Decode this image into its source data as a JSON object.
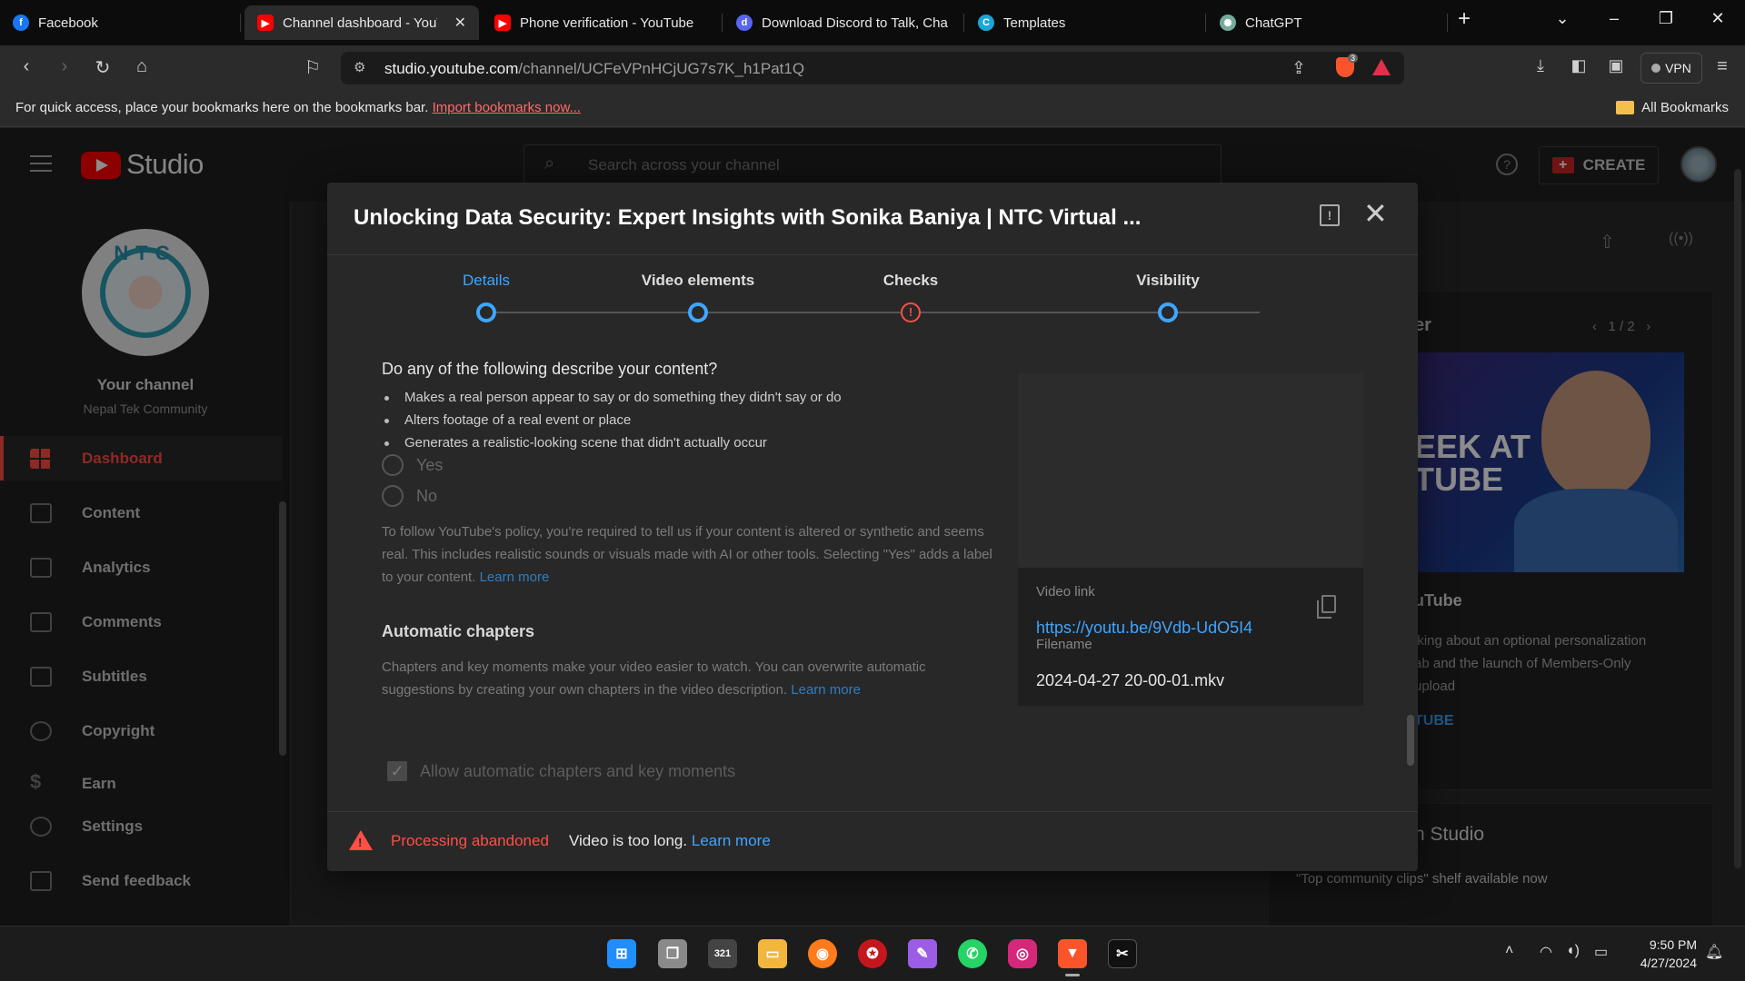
{
  "browser": {
    "tabs": [
      {
        "title": "Facebook",
        "icon": "facebook-icon",
        "color": "#1877f2",
        "glyph": "f"
      },
      {
        "title": "Channel dashboard - YouTube Studio",
        "icon": "youtube-icon",
        "color": "#ff0000",
        "glyph": "▶",
        "active": true
      },
      {
        "title": "Phone verification - YouTube",
        "icon": "youtube-icon",
        "color": "#ff0000",
        "glyph": "▶"
      },
      {
        "title": "Download Discord to Talk, Chat",
        "icon": "discord-icon",
        "color": "#5865f2",
        "glyph": "d"
      },
      {
        "title": "Templates",
        "icon": "canva-icon",
        "color": "#1aa6d6",
        "glyph": "C"
      },
      {
        "title": "ChatGPT",
        "icon": "chatgpt-icon",
        "color": "#74aa9c",
        "glyph": "✺"
      }
    ],
    "url_host": "studio.youtube.com",
    "url_path": "/channel/UCFeVPnHCjUG7s7K_h1Pat1Q",
    "brave_badge": "3",
    "vpn_label": "VPN",
    "bookmarks_msg": "For quick access, place your bookmarks here on the bookmarks bar.",
    "bookmarks_link": "Import bookmarks now...",
    "all_bookmarks": "All Bookmarks"
  },
  "studio": {
    "logo_text": "Studio",
    "search_placeholder": "Search across your channel",
    "create_label": "CREATE",
    "channel_title": "Your channel",
    "channel_name": "Nepal Tek Community",
    "avatar_text": "NTC",
    "nav": [
      {
        "label": "Dashboard",
        "icon": "dashboard-icon",
        "active": true
      },
      {
        "label": "Content",
        "icon": "content-icon"
      },
      {
        "label": "Analytics",
        "icon": "analytics-icon"
      },
      {
        "label": "Comments",
        "icon": "comments-icon"
      },
      {
        "label": "Subtitles",
        "icon": "subtitles-icon"
      },
      {
        "label": "Copyright",
        "icon": "copyright-icon"
      },
      {
        "label": "Earn",
        "icon": "earn-icon"
      },
      {
        "label": "Settings",
        "icon": "settings-icon"
      },
      {
        "label": "Send feedback",
        "icon": "feedback-icon"
      }
    ],
    "bg_card": {
      "title_fragment": "er",
      "pager": "1 / 2",
      "thumb_text_1": "EEK AT",
      "thumb_text_2": "TUBE",
      "headline_fragment": "uTube",
      "desc_1": "lking about an optional personalization",
      "desc_2": "ab and the launch of Members-Only",
      "desc_3": "upload",
      "link_fragment": "TUBE"
    },
    "bg_news": {
      "title_fragment": "n Studio",
      "item": "\"Top community clips\" shelf available now"
    }
  },
  "dialog": {
    "title": "Unlocking Data Security: Expert Insights with Sonika Baniya | NTC Virtual ...",
    "steps": [
      {
        "label": "Details",
        "state": "active"
      },
      {
        "label": "Video elements",
        "state": "done"
      },
      {
        "label": "Checks",
        "state": "warning"
      },
      {
        "label": "Visibility",
        "state": "done"
      }
    ],
    "question": "Do any of the following describe your content?",
    "bullets": [
      "Makes a real person appear to say or do something they didn't say or do",
      "Alters footage of a real event or place",
      "Generates a realistic-looking scene that didn't actually occur"
    ],
    "radio_yes": "Yes",
    "radio_no": "No",
    "policy_text": "To follow YouTube's policy, you're required to tell us if your content is altered or synthetic and seems real. This includes realistic sounds or visuals made with AI or other tools. Selecting \"Yes\" adds a label to your content.",
    "policy_link": "Learn more",
    "chapters_title": "Automatic chapters",
    "chapters_text": "Chapters and key moments make your video easier to watch. You can overwrite automatic suggestions by creating your own chapters in the video description.",
    "chapters_link": "Learn more",
    "chapters_checkbox": "Allow automatic chapters and key moments",
    "video_link_label": "Video link",
    "video_link": "https://youtu.be/9Vdb-UdO5I4",
    "filename_label": "Filename",
    "filename": "2024-04-27 20-00-01.mkv",
    "footer_status": "Processing abandoned",
    "footer_msg": "Video is too long.",
    "footer_link": "Learn more"
  },
  "taskbar": {
    "apps": [
      {
        "name": "windows-start-icon",
        "color": "#1f8fff",
        "glyph": "⊞"
      },
      {
        "name": "task-view-icon",
        "color": "#8a8a8a",
        "glyph": "❐"
      },
      {
        "name": "calendar-app-icon",
        "color": "#444444",
        "glyph": "321"
      },
      {
        "name": "file-explorer-icon",
        "color": "#f2b63c",
        "glyph": "▭"
      },
      {
        "name": "firefox-icon",
        "color": "#ff7a1a",
        "glyph": "◉"
      },
      {
        "name": "app-red-icon",
        "color": "#c4161c",
        "glyph": "✪"
      },
      {
        "name": "paint-app-icon",
        "color": "#9b5de5",
        "glyph": "✎"
      },
      {
        "name": "whatsapp-icon",
        "color": "#25d366",
        "glyph": "✆"
      },
      {
        "name": "instagram-icon",
        "color": "#d6287a",
        "glyph": "◎"
      },
      {
        "name": "brave-icon",
        "color": "#fb542b",
        "glyph": "▼",
        "active": true
      },
      {
        "name": "capcut-icon",
        "color": "#111111",
        "glyph": "✂"
      }
    ],
    "time": "9:50 PM",
    "date": "4/27/2024"
  }
}
